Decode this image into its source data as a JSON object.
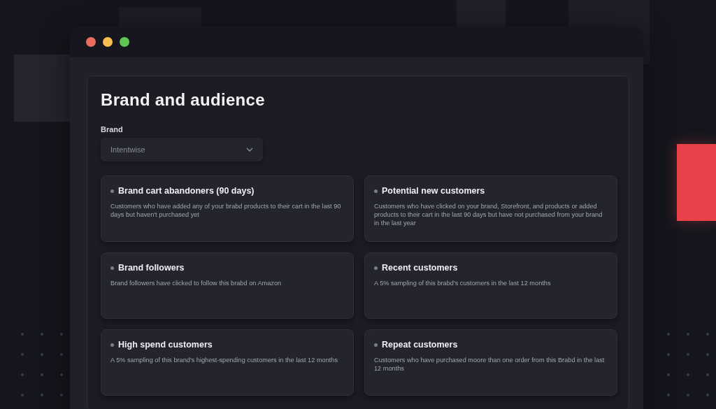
{
  "window": {
    "controls": [
      {
        "color": "#ed6a5e"
      },
      {
        "color": "#f4bf4f"
      },
      {
        "color": "#61c554"
      }
    ]
  },
  "page": {
    "title": "Brand and audience",
    "brand_field": {
      "label": "Brand",
      "value": "Intentwise"
    }
  },
  "audiences": [
    {
      "title": "Brand cart abandoners (90 days)",
      "description": "Customers who have added any of your brabd products to their cart in the last 90 days but haven't purchased yet"
    },
    {
      "title": "Potential new customers",
      "description": "Customers who have clicked on your brand, Storefront, and products or added products to their cart in the last 90 days but have not purchased from your brand in the last year"
    },
    {
      "title": "Brand followers",
      "description": "Brand followers have clicked to follow this brabd on Amazon"
    },
    {
      "title": "Recent customers",
      "description": "A 5% sampling of this brabd's customers in the last 12 months"
    },
    {
      "title": "High spend customers",
      "description": "A 5% sampling of this brand's highest-spending customers in the last 12 months"
    },
    {
      "title": "Repeat customers",
      "description": "Customers who have purchased moore than one order from this Brabd in the last 12 months"
    }
  ]
}
